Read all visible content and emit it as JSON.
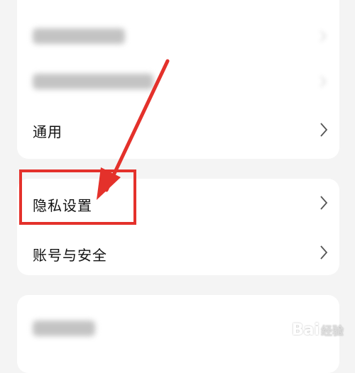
{
  "settings": {
    "general_label": "通用",
    "privacy_label": "隐私设置",
    "account_label": "账号与安全"
  },
  "watermark": {
    "brand": "Bai",
    "sub": "经验"
  },
  "colors": {
    "annotation": "#e4312b",
    "background": "#f4f4f4",
    "card": "#ffffff"
  }
}
